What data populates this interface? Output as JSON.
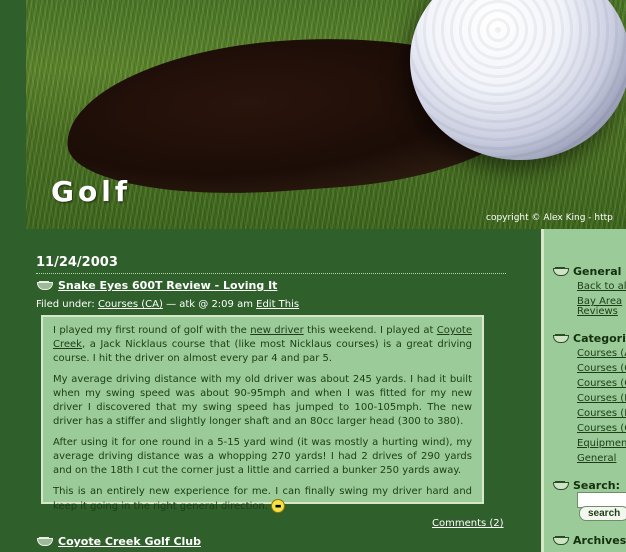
{
  "header": {
    "site_title": "Golf",
    "copyright": "copyright © Alex King - http"
  },
  "post": {
    "date": "11/24/2003",
    "title": "Snake Eyes 600T Review - Loving It",
    "meta_prefix": "Filed under:",
    "category": "Courses (CA)",
    "meta_suffix": "— atk @ 2:09 am",
    "edit_link": "Edit This",
    "paragraphs": {
      "p1_a": "I played my first round of golf with the",
      "p1_link1": "new driver",
      "p1_b": "this weekend. I played at",
      "p1_link2": "Coyote Creek",
      "p1_c": ", a Jack Nicklaus course that (like most Nicklaus courses) is a great driving course. I hit the driver on almost every par 4 and par 5.",
      "p2": "My average driving distance with my old driver was about 245 yards. I had it built when my swing speed was about 90-95mph and when I was fitted for my new driver I discovered that my swing speed has jumped to 100-105mph. The new driver has a stiffer and slightly longer shaft and an 80cc larger head (300 to 380).",
      "p3": "After using it for one round in a 5-15 yard wind (it was mostly a hurting wind), my average driving distance was a whopping 270 yards! I had 2 drives of 290 yards and on the 18th I cut the corner just a little and carried a bunker 250 yards away.",
      "p4": "This is an entirely new experience for me. I can finally swing my driver hard and keep it going in the right general direction."
    },
    "comments_link": "Comments (2)"
  },
  "next_post": {
    "title": "Coyote Creek Golf Club"
  },
  "sidebar": {
    "general_heading": "General",
    "general_links": [
      "Back to al",
      "Bay Area",
      "Reviews"
    ],
    "categories_heading": "Categorie",
    "category_links": [
      "Courses (A",
      "Courses (C",
      "Courses (C",
      "Courses (I",
      "Courses (I",
      "Courses (C",
      "Equipmen",
      "General"
    ],
    "search_heading": "Search:",
    "search_button": "search",
    "archives_heading": "Archives:"
  },
  "colors": {
    "background": "#2f5f2a",
    "panel": "#9bcb98",
    "border": "#d8e7c9"
  }
}
